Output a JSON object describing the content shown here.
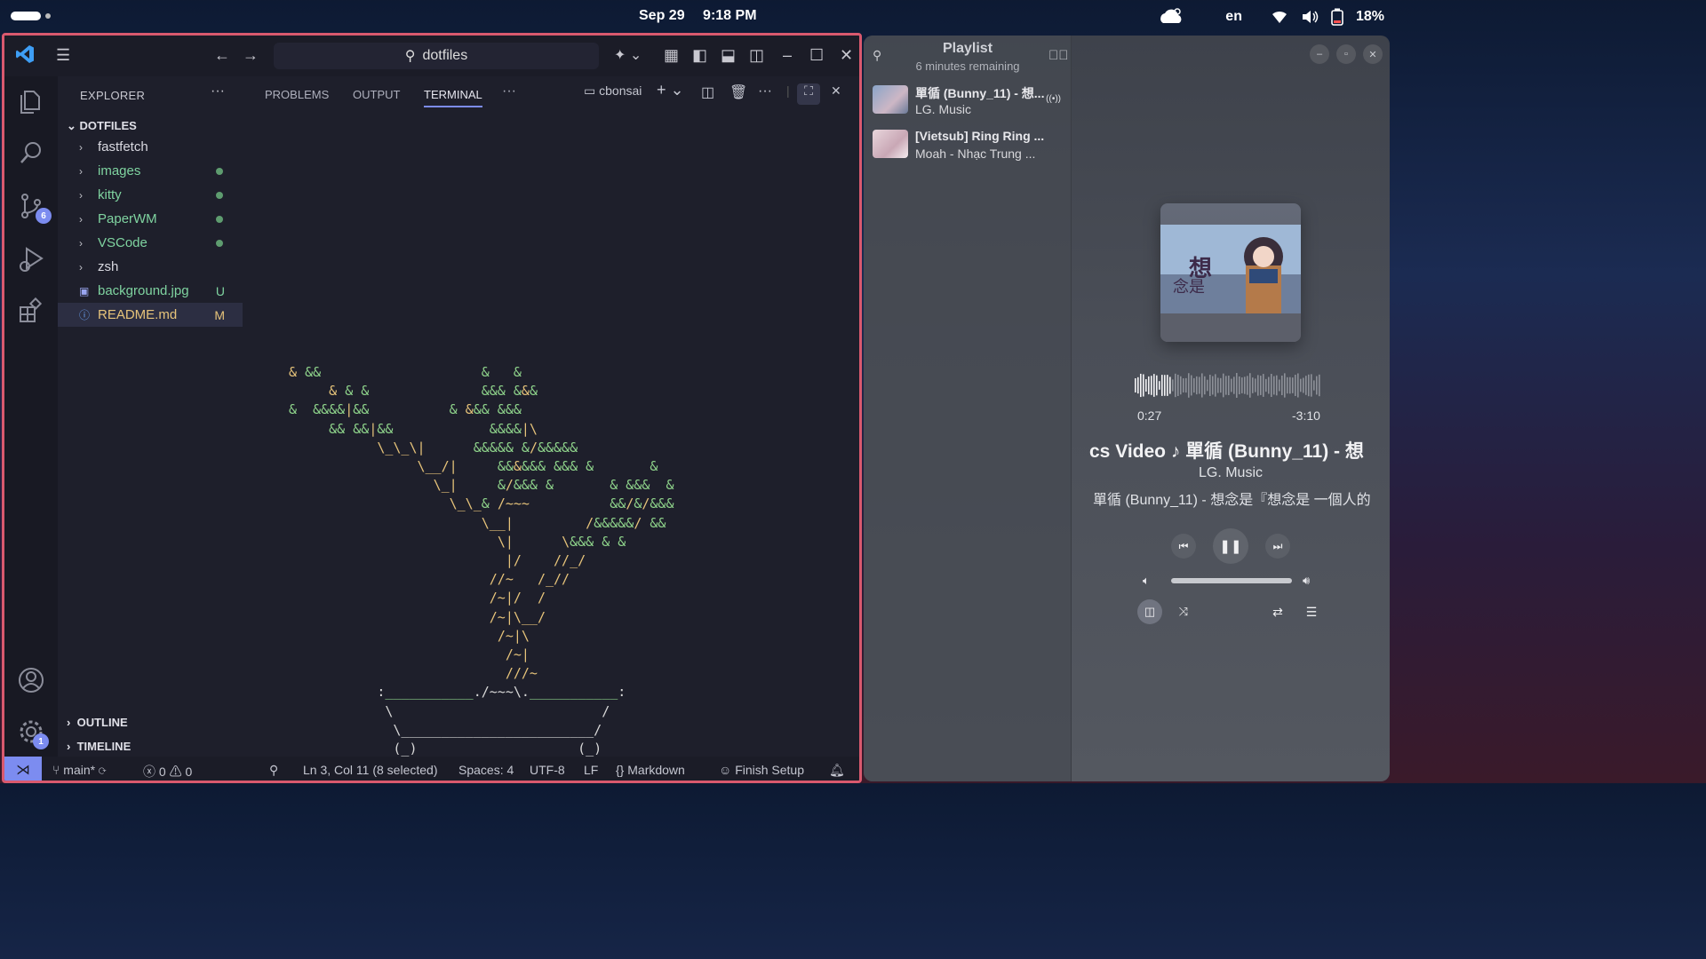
{
  "topbar": {
    "date": "Sep 29",
    "time": "9:18 PM",
    "language": "en",
    "battery": "18%",
    "icons": [
      "weather-night-cloud-icon",
      "wifi-icon",
      "volume-icon",
      "battery-charging-icon"
    ]
  },
  "vscode": {
    "search_text": "dotfiles",
    "sidebar": {
      "title": "EXPLORER",
      "root": "DOTFILES",
      "items": [
        {
          "label": "fastfetch",
          "type": "folder",
          "status": ""
        },
        {
          "label": "images",
          "type": "folder",
          "status": "dot"
        },
        {
          "label": "kitty",
          "type": "folder",
          "status": "dot"
        },
        {
          "label": "PaperWM",
          "type": "folder",
          "status": "dot"
        },
        {
          "label": "VSCode",
          "type": "folder",
          "status": "dot"
        },
        {
          "label": "zsh",
          "type": "folder",
          "status": ""
        },
        {
          "label": "background.jpg",
          "type": "file",
          "status": "U"
        },
        {
          "label": "README.md",
          "type": "file",
          "status": "M"
        }
      ],
      "outline": "OUTLINE",
      "timeline": "TIMELINE"
    },
    "badges": {
      "source_control": "6",
      "settings": "1"
    },
    "panel": {
      "tabs": [
        "PROBLEMS",
        "OUTPUT",
        "TERMINAL"
      ],
      "active_tab": "TERMINAL",
      "terminal_name": "cbonsai"
    },
    "statusbar": {
      "branch": "main*",
      "errors": "0",
      "warnings": "0",
      "cursor": "Ln 3, Col 11 (8 selected)",
      "spaces": "Spaces: 4",
      "encoding": "UTF-8",
      "eol": "LF",
      "language": "Markdown",
      "finish_setup": "Finish Setup"
    },
    "colors": {
      "accent": "#7c8cf0",
      "border": "#d9596e",
      "leaf": "#8fd48b",
      "trunk": "#e6c37a"
    }
  },
  "player": {
    "playlist_title": "Playlist",
    "playlist_sub": "6 minutes remaining",
    "tracks": [
      {
        "title": "單循 (Bunny_11) - 想...",
        "artist": "LG. Music"
      },
      {
        "title": "[Vietsub] Ring Ring ...",
        "artist": "Moah - Nhạc Trung ..."
      }
    ],
    "elapsed": "0:27",
    "remaining": "-3:10",
    "now_title": "cs Video ♪    單循 (Bunny_11) - 想",
    "now_artist": "LG. Music",
    "now_album": "單循 (Bunny_11) - 想念是『想念是 一個人的",
    "volume": 1.0
  }
}
